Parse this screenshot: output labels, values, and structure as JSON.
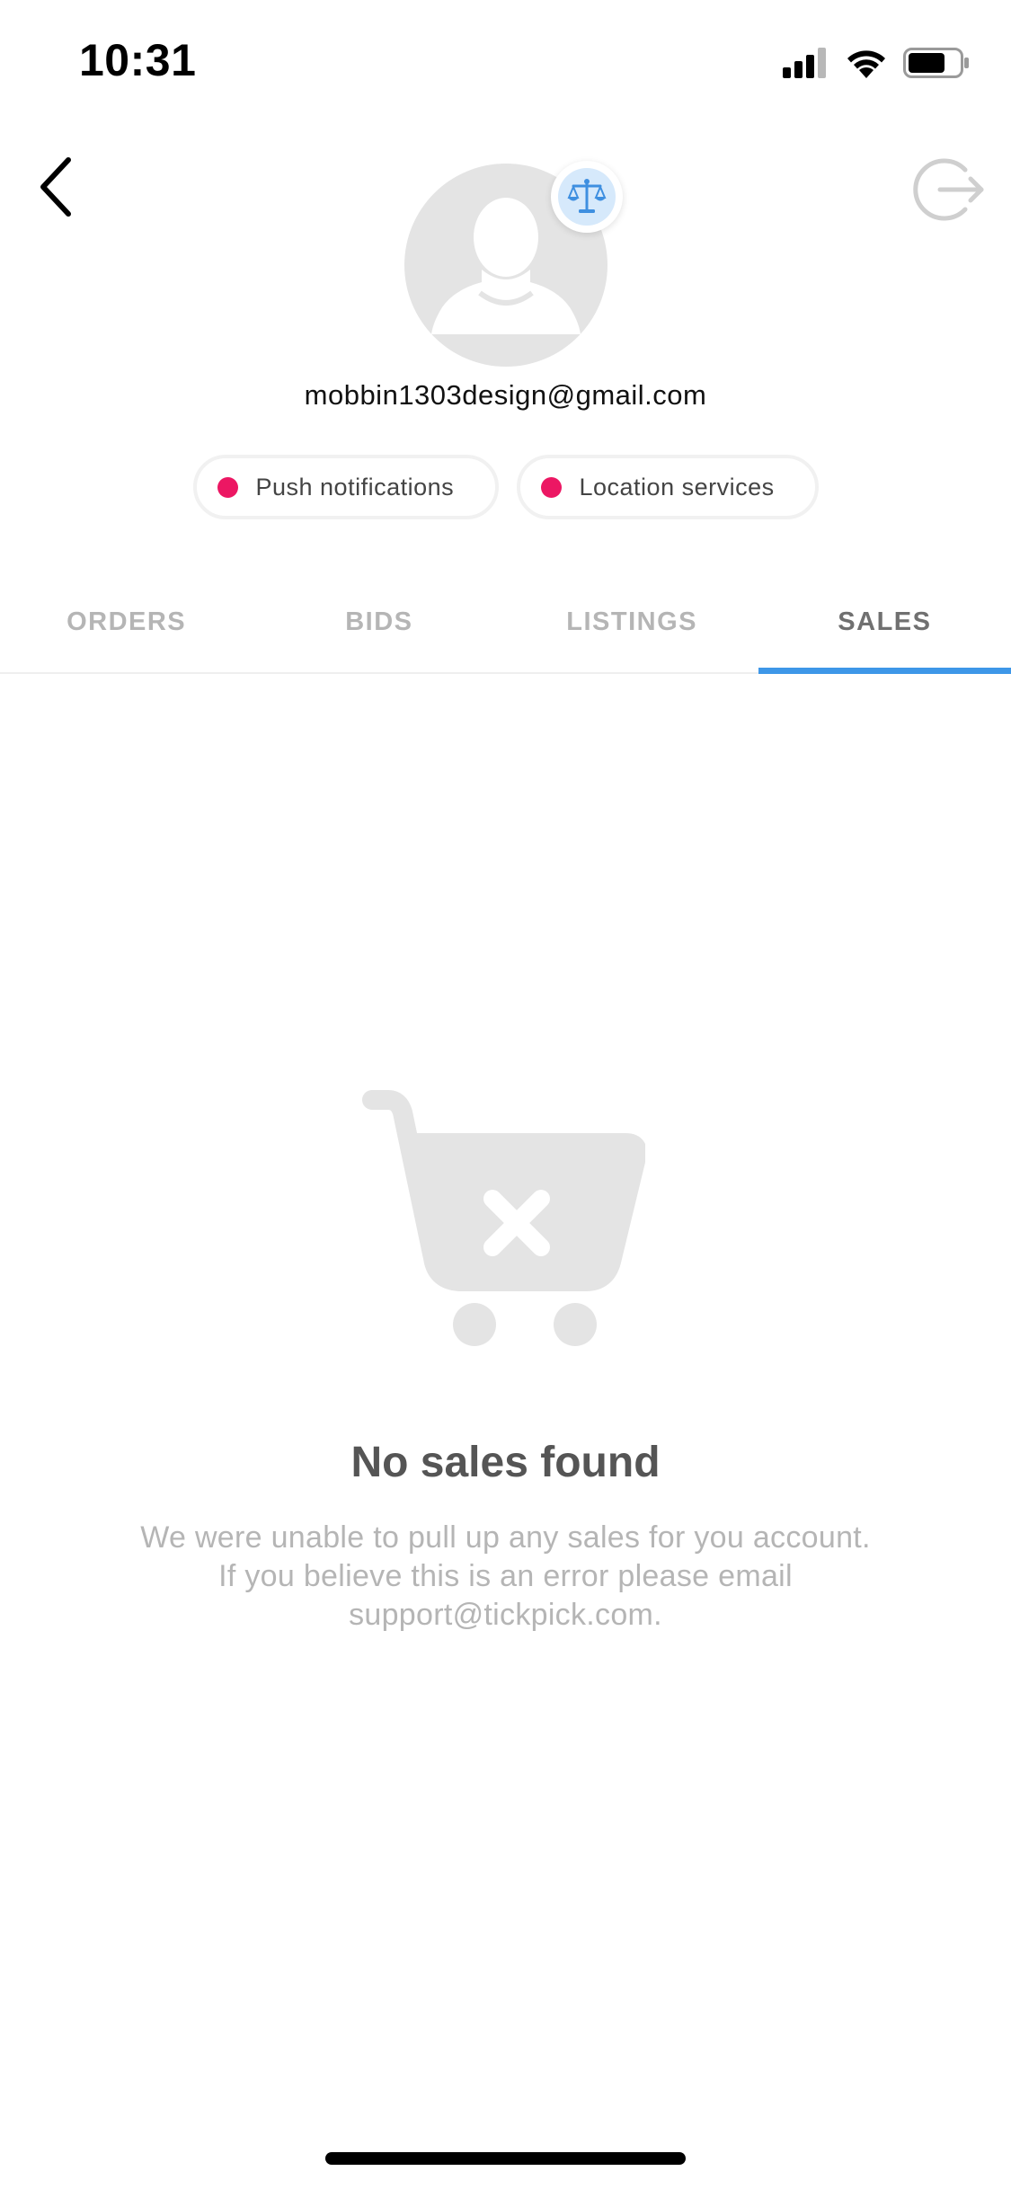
{
  "status_bar": {
    "time": "10:31",
    "icons": [
      "cellular-signal-icon",
      "wifi-icon",
      "battery-icon"
    ]
  },
  "header": {
    "back_icon": "chevron-left-icon",
    "logout_icon": "logout-icon",
    "avatar_icon": "user-placeholder-icon",
    "badge_icon": "scales-icon",
    "email": "mobbin1303design@gmail.com"
  },
  "chips": {
    "push": "Push notifications",
    "location": "Location services",
    "dot_color": "#ec1763"
  },
  "tabs": [
    {
      "label": "ORDERS",
      "active": false
    },
    {
      "label": "BIDS",
      "active": false
    },
    {
      "label": "LISTINGS",
      "active": false
    },
    {
      "label": "SALES",
      "active": true
    }
  ],
  "empty_state": {
    "icon": "empty-cart-icon",
    "title": "No sales found",
    "line1": "We were unable to pull up any sales for you account.",
    "line2": "If you believe this is an error please email",
    "line3": "support@tickpick.com."
  },
  "colors": {
    "accent": "#3e97e8",
    "active_tab_text": "#707070",
    "inactive_tab_text": "#b5b5b5",
    "placeholder_gray": "#e4e4e4"
  }
}
